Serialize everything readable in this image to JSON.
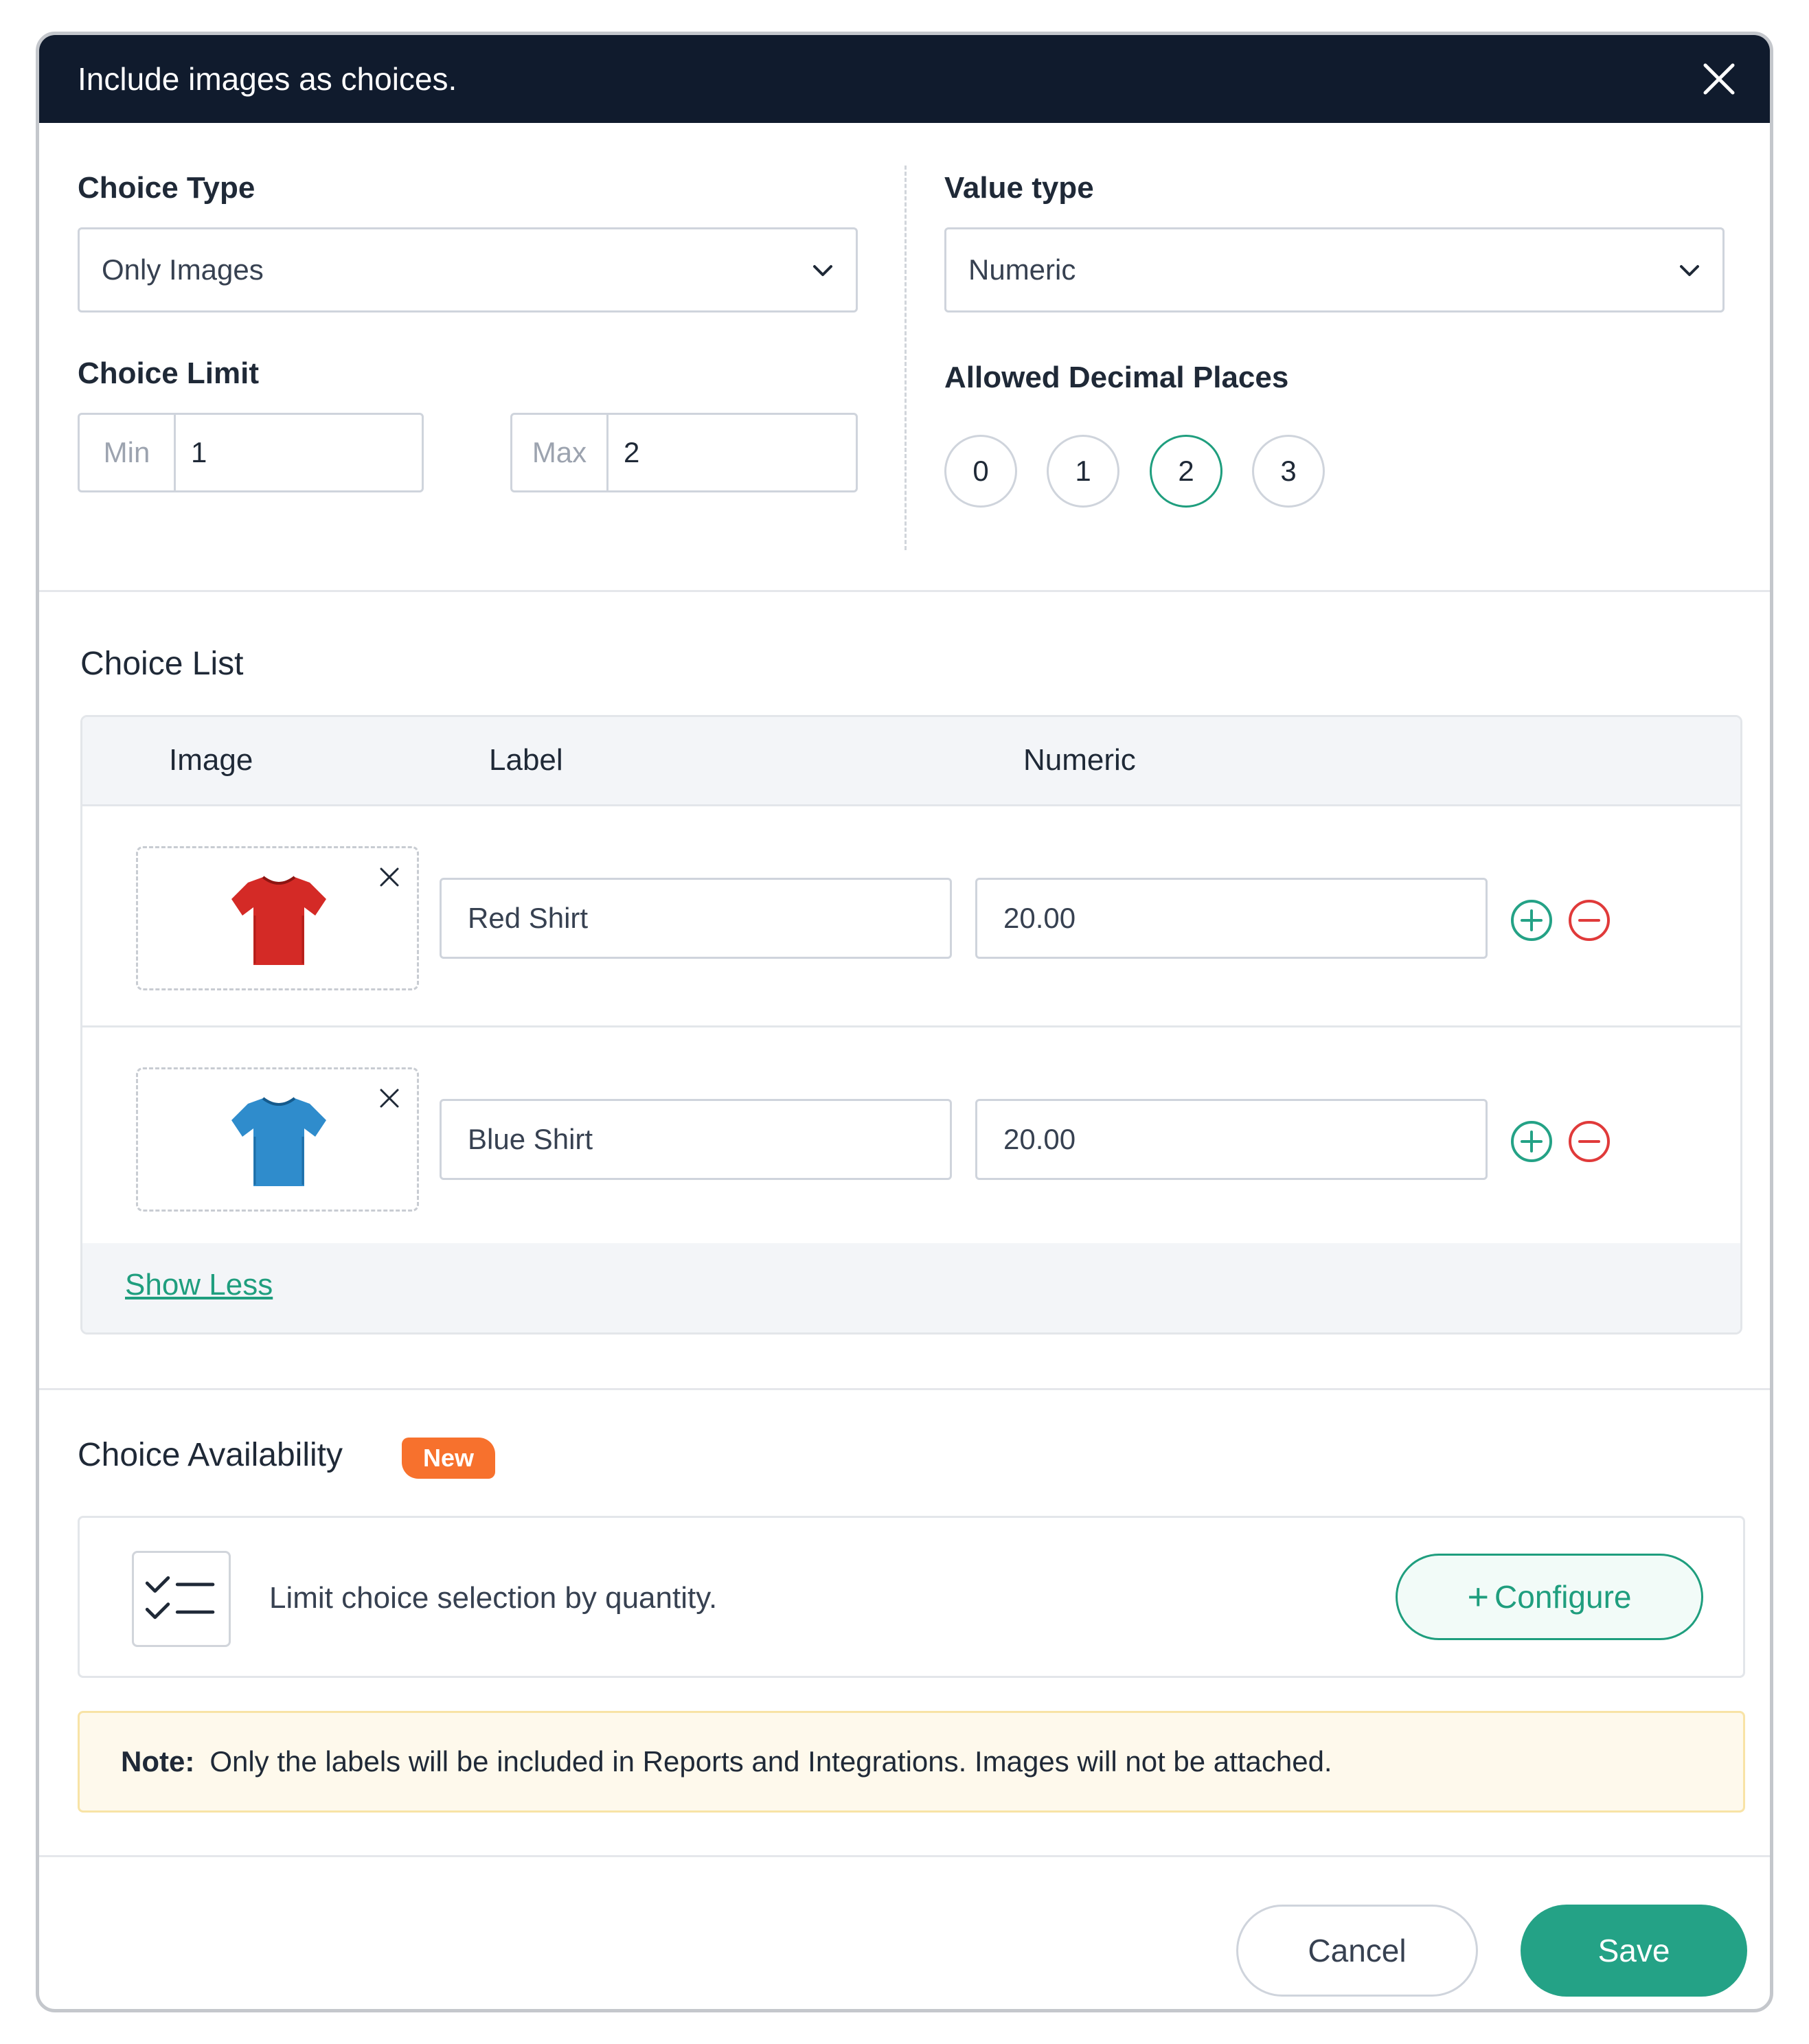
{
  "modal": {
    "title": "Include images as choices."
  },
  "choice_type": {
    "label": "Choice Type",
    "value": "Only Images"
  },
  "choice_limit": {
    "label": "Choice Limit",
    "min_prefix": "Min",
    "min_value": "1",
    "max_prefix": "Max",
    "max_value": "2"
  },
  "value_type": {
    "label": "Value type",
    "value": "Numeric"
  },
  "decimal_places": {
    "label": "Allowed Decimal Places",
    "options": [
      "0",
      "1",
      "2",
      "3"
    ],
    "selected": "2"
  },
  "choice_list": {
    "title": "Choice List",
    "columns": [
      "Image",
      "Label",
      "Numeric"
    ],
    "rows": [
      {
        "label": "Red Shirt",
        "numeric": "20.00",
        "image_icon": "red-shirt-image"
      },
      {
        "label": "Blue Shirt",
        "numeric": "20.00",
        "image_icon": "blue-shirt-image"
      }
    ],
    "show_less": "Show Less"
  },
  "choice_availability": {
    "title": "Choice Availability",
    "badge": "New",
    "text": "Limit choice selection by quantity.",
    "configure_label": "Configure"
  },
  "note": {
    "bold": "Note:",
    "text": "Only the labels will be included in Reports and Integrations. Images will not be attached."
  },
  "footer": {
    "cancel": "Cancel",
    "save": "Save"
  },
  "colors": {
    "header_bg": "#101b2d",
    "accent": "#24a286",
    "danger": "#e03a3a",
    "badge": "#f7712d"
  }
}
